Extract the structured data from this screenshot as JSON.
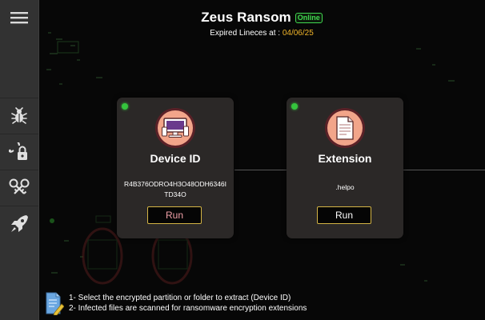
{
  "app": {
    "title": "Zeus Ransom",
    "status": "Online",
    "expiry_label": "Expired Lineces at :",
    "expiry_date": "04/06/25"
  },
  "colors": {
    "sidebar": "#323232",
    "card": "#2b2827",
    "status_green": "#41d94f",
    "accent_gold": "#d4b445",
    "date_orange": "#f0b429"
  },
  "sidebar": {
    "menu_icon": "hamburger-icon",
    "items": [
      {
        "icon": "bug-icon"
      },
      {
        "icon": "unlock-icon"
      },
      {
        "icon": "keys-icon"
      },
      {
        "icon": "rocket-icon"
      }
    ]
  },
  "cards": [
    {
      "icon": "monitor-icon",
      "title": "Device ID",
      "value": "R4B376ODRO4H3O48ODH6346ITD34O",
      "button_label": "Run"
    },
    {
      "icon": "document-icon",
      "title": "Extension",
      "value": ".helpo",
      "button_label": "Run"
    }
  ],
  "footer": {
    "icon": "note-pencil-icon",
    "lines": [
      "1- Select the encrypted partition or folder to extract (Device ID)",
      "2- Infected files are scanned for ransomware encryption extensions"
    ]
  }
}
